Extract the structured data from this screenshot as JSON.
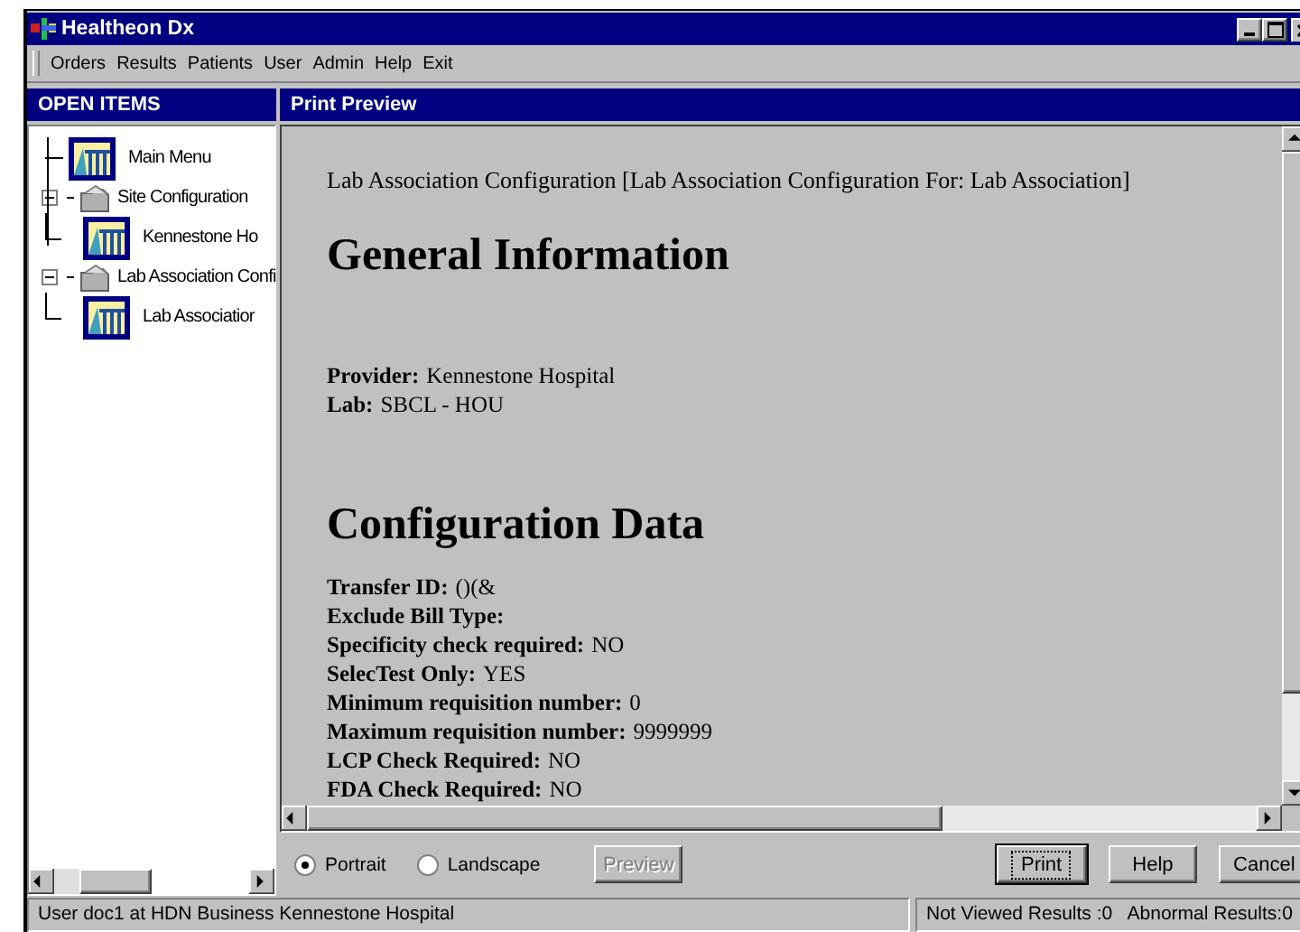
{
  "window": {
    "title": "Healtheon Dx"
  },
  "menu": [
    "Orders",
    "Results",
    "Patients",
    "User",
    "Admin",
    "Help",
    "Exit"
  ],
  "open_items": {
    "title": "OPEN ITEMS",
    "tree": [
      {
        "label": "Main Menu",
        "kind": "page"
      },
      {
        "label": "Site Configuration",
        "kind": "folder",
        "expanded": true,
        "children": [
          {
            "label": "Kennestone Ho",
            "kind": "page"
          }
        ]
      },
      {
        "label": "Lab Association Confi",
        "kind": "folder",
        "expanded": true,
        "children": [
          {
            "label": "Lab Associatior",
            "kind": "page"
          }
        ]
      }
    ]
  },
  "preview": {
    "title": "Print Preview",
    "caption": "Lab Association Configuration [Lab Association Configuration For: Lab Association]",
    "sections": [
      {
        "heading": "General Information",
        "fields": [
          {
            "label": "Provider:",
            "value": "Kennestone Hospital"
          },
          {
            "label": "Lab:",
            "value": "SBCL - HOU"
          }
        ]
      },
      {
        "heading": "Configuration Data",
        "fields": [
          {
            "label": "Transfer ID:",
            "value": "()(&"
          },
          {
            "label": "Exclude Bill Type:"
          },
          {
            "label": "Specificity check required:",
            "value": "NO"
          },
          {
            "label": "SelecTest Only:",
            "value": "YES"
          },
          {
            "label": "Minimum requisition number:",
            "value": "0"
          },
          {
            "label": "Maximum requisition number:",
            "value": "9999999"
          },
          {
            "label": "LCP Check Required:",
            "value": "NO"
          },
          {
            "label": "FDA Check Required:",
            "value": "NO"
          }
        ]
      }
    ]
  },
  "orientation": [
    {
      "label": "Portrait",
      "selected": true
    },
    {
      "label": "Landscape",
      "selected": false
    }
  ],
  "buttons": [
    {
      "label": "Preview",
      "disabled": true,
      "focused": false
    },
    {
      "label": "Print",
      "disabled": false,
      "focused": true
    },
    {
      "label": "Help",
      "disabled": false,
      "focused": false
    },
    {
      "label": "Cancel",
      "disabled": false,
      "focused": false
    }
  ],
  "status_bar": [
    "User doc1 at HDN Business Kennestone Hospital",
    "Not Viewed Results :0   Abnormal Results:0"
  ]
}
